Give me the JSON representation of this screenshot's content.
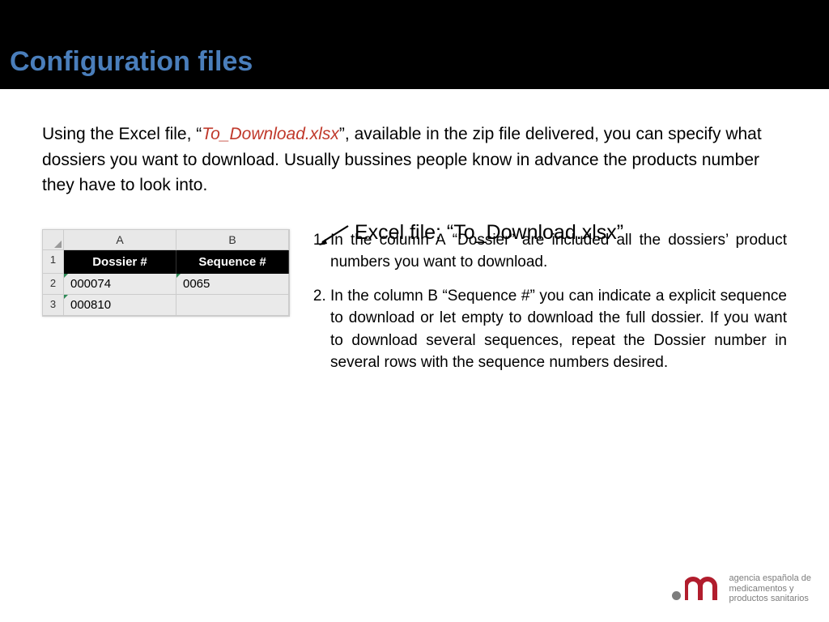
{
  "header": {
    "title": "Configuration files"
  },
  "intro": {
    "before": "Using the Excel file, “",
    "filename": "To_Download.xlsx",
    "after": "”, available in the zip file delivered, you can specify what dossiers you want to download. Usually bussines people know in advance the products number they have to look into."
  },
  "excel_caption": "Excel file: “To_Download.xlsx”",
  "chart_data": {
    "type": "table",
    "columns": [
      "A",
      "B"
    ],
    "headers": [
      "Dossier #",
      "Sequence #"
    ],
    "rows": [
      {
        "n": "1",
        "a": "",
        "b": ""
      },
      {
        "n": "2",
        "a": "000074",
        "b": "0065"
      },
      {
        "n": "3",
        "a": "000810",
        "b": ""
      }
    ]
  },
  "list": {
    "item1": "In the column A “Dossier” are included all the dossiers’ product numbers you want to download.",
    "item2": "In the column B “Sequence #” you can indicate a explicit sequence to download or let empty to download the full dossier. If you want to download several sequences, repeat the Dossier number in several rows with the sequence numbers desired."
  },
  "footer": {
    "line1": "agencia española de",
    "line2": "medicamentos y",
    "line3": "productos sanitarios"
  }
}
